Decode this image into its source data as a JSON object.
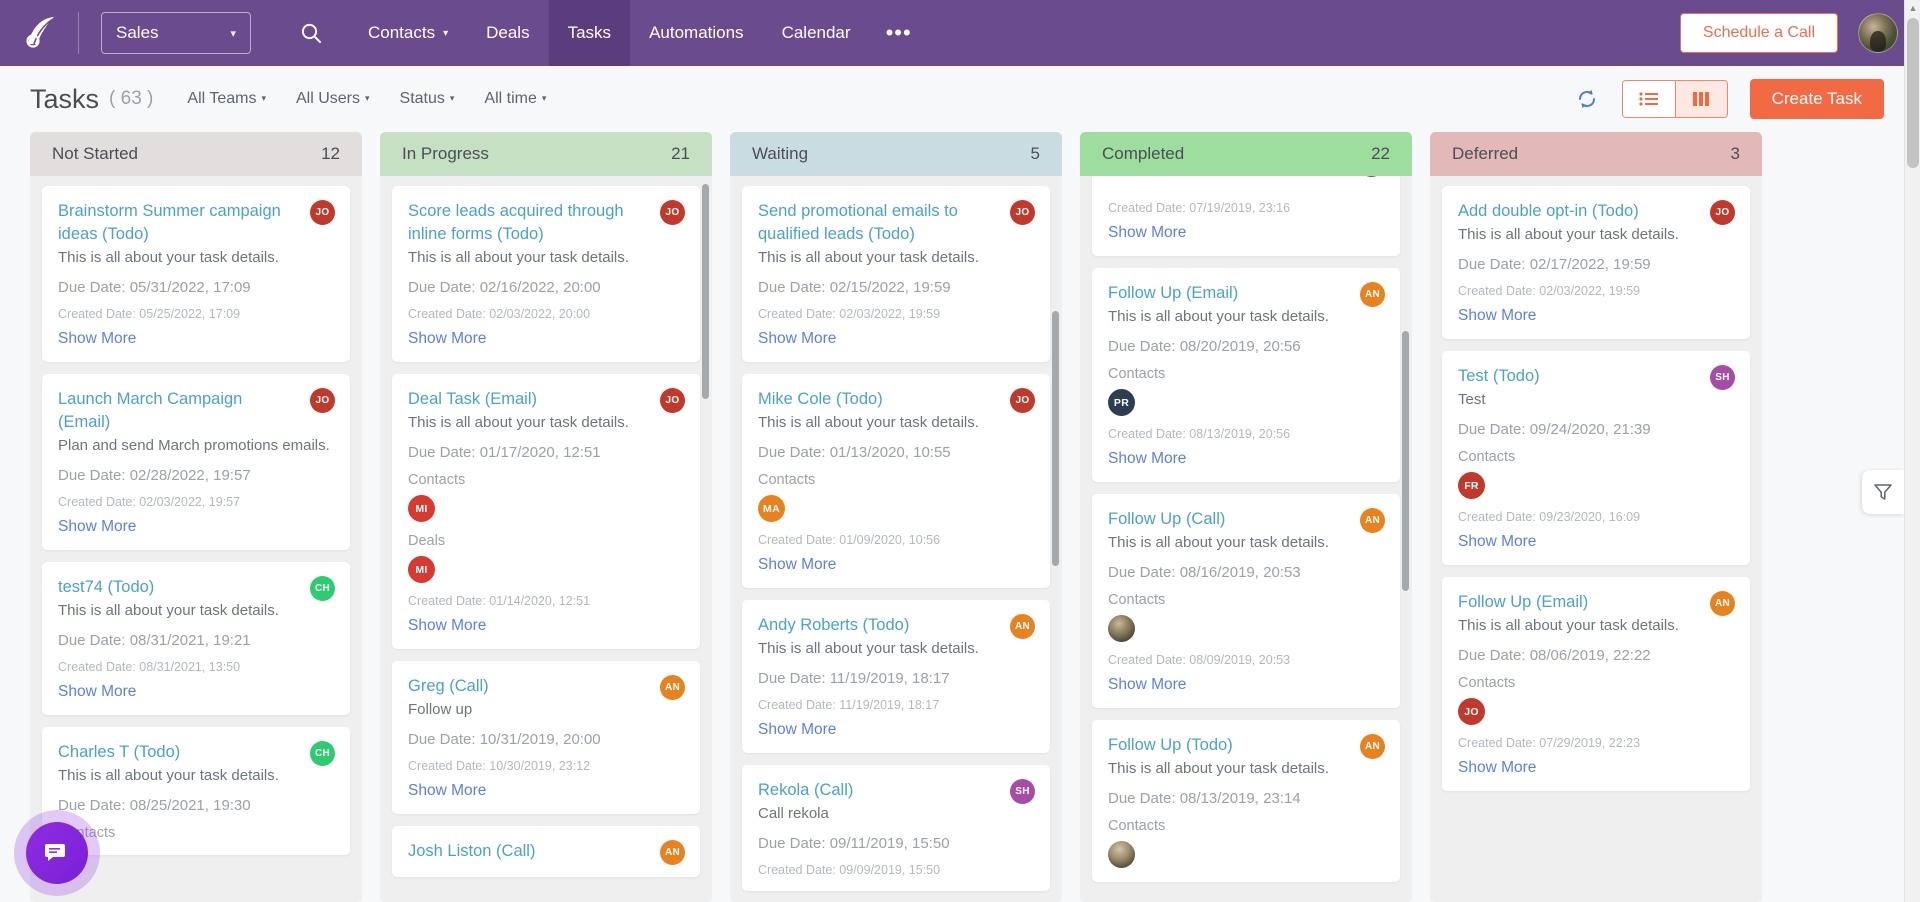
{
  "topnav": {
    "logo_name": "agile-crm-logo",
    "pipeline": {
      "label": "Sales",
      "caret": "▾"
    },
    "search_icon": "search-icon",
    "links": [
      {
        "label": "Contacts",
        "has_caret": true,
        "active": false
      },
      {
        "label": "Deals",
        "has_caret": false,
        "active": false
      },
      {
        "label": "Tasks",
        "has_caret": false,
        "active": true
      },
      {
        "label": "Automations",
        "has_caret": false,
        "active": false
      },
      {
        "label": "Calendar",
        "has_caret": false,
        "active": false
      }
    ],
    "more_label": "•••",
    "schedule_label": "Schedule a Call",
    "accent_purple": "#6a4b8e",
    "accent_orange": "#f26a44"
  },
  "toolbar": {
    "title": "Tasks",
    "count": "( 63 )",
    "filters": [
      {
        "label": "All Teams"
      },
      {
        "label": "All Users"
      },
      {
        "label": "Status"
      },
      {
        "label": "All time"
      }
    ],
    "caret": "▾",
    "refresh_icon": "refresh-icon",
    "list_view_icon": "list-view-icon",
    "board_view_icon": "board-view-icon",
    "create_label": "Create Task"
  },
  "common": {
    "due_prefix": "Due Date: ",
    "created_prefix": "Created Date: ",
    "show_more": "Show More",
    "contacts_label": "Contacts",
    "deals_label": "Deals"
  },
  "columns": [
    {
      "name": "Not Started",
      "count": "12",
      "header_bg": "#e2dedd",
      "cards": [
        {
          "title": "Brainstorm Summer campaign ideas (Todo)",
          "desc": "This is all about your task details.",
          "due": "Due Date: 05/31/2022, 17:09",
          "created": "Created Date: 05/25/2022, 17:09",
          "show_more": "Show More",
          "avatar": {
            "initials": "JO",
            "color": "#c0392b"
          }
        },
        {
          "title": "Launch March Campaign (Email)",
          "desc": "Plan and send March promotions emails.",
          "due": "Due Date: 02/28/2022, 19:57",
          "created": "Created Date: 02/03/2022, 19:57",
          "show_more": "Show More",
          "avatar": {
            "initials": "JO",
            "color": "#c0392b"
          }
        },
        {
          "title": "test74 (Todo)",
          "desc": "This is all about your task details.",
          "due": "Due Date: 08/31/2021, 19:21",
          "created": "Created Date: 08/31/2021, 13:50",
          "show_more": "Show More",
          "avatar": {
            "initials": "CH",
            "color": "#2ecc71"
          }
        },
        {
          "title": "Charles T (Todo)",
          "desc": "This is all about your task details.",
          "due": "Due Date: 08/25/2021, 19:30",
          "contacts_label": "Contacts",
          "avatar": {
            "initials": "CH",
            "color": "#2ecc71"
          }
        }
      ]
    },
    {
      "name": "In Progress",
      "count": "21",
      "header_bg": "#c5e0c3",
      "cards": [
        {
          "title": "Score leads acquired through inline forms (Todo)",
          "desc": "This is all about your task details.",
          "due": "Due Date: 02/16/2022, 20:00",
          "created": "Created Date: 02/03/2022, 20:00",
          "show_more": "Show More",
          "avatar": {
            "initials": "JO",
            "color": "#c0392b"
          }
        },
        {
          "title": "Deal Task (Email)",
          "desc": "This is all about your task details.",
          "due": "Due Date: 01/17/2020, 12:51",
          "contacts_label": "Contacts",
          "contacts": [
            {
              "initials": "MI",
              "color": "#d63a30"
            }
          ],
          "deals_label": "Deals",
          "deals": [
            {
              "initials": "MI",
              "color": "#d63a30"
            }
          ],
          "created": "Created Date: 01/14/2020, 12:51",
          "show_more": "Show More",
          "avatar": {
            "initials": "JO",
            "color": "#c0392b"
          }
        },
        {
          "title": "Greg (Call)",
          "desc": "Follow up",
          "due": "Due Date: 10/31/2019, 20:00",
          "created": "Created Date: 10/30/2019, 23:12",
          "show_more": "Show More",
          "avatar": {
            "initials": "AN",
            "color": "#e8821e"
          }
        },
        {
          "title": "Josh Liston (Call)",
          "avatar": {
            "initials": "AN",
            "color": "#e8821e"
          }
        }
      ]
    },
    {
      "name": "Waiting",
      "count": "5",
      "header_bg": "#c9dce2",
      "cards": [
        {
          "title": "Send promotional emails to qualified leads (Todo)",
          "desc": "This is all about your task details.",
          "due": "Due Date: 02/15/2022, 19:59",
          "created": "Created Date: 02/03/2022, 19:59",
          "show_more": "Show More",
          "avatar": {
            "initials": "JO",
            "color": "#c0392b"
          }
        },
        {
          "title": "Mike Cole (Todo)",
          "desc": "This is all about your task details.",
          "due": "Due Date: 01/13/2020, 10:55",
          "contacts_label": "Contacts",
          "contacts": [
            {
              "initials": "MA",
              "color": "#e8821e"
            }
          ],
          "created": "Created Date: 01/09/2020, 10:56",
          "show_more": "Show More",
          "avatar": {
            "initials": "JO",
            "color": "#c0392b"
          }
        },
        {
          "title": "Andy Roberts (Todo)",
          "desc": "This is all about your task details.",
          "due": "Due Date: 11/19/2019, 18:17",
          "created": "Created Date: 11/19/2019, 18:17",
          "show_more": "Show More",
          "avatar": {
            "initials": "AN",
            "color": "#e8821e"
          }
        },
        {
          "title": "Rekola (Call)",
          "desc": "Call rekola",
          "due": "Due Date: 09/11/2019, 15:50",
          "created": "Created Date: 09/09/2019, 15:50",
          "avatar": {
            "initials": "SH",
            "color": "#a64ca6"
          }
        }
      ]
    },
    {
      "name": "Completed",
      "count": "22",
      "header_bg": "#9ddd9d",
      "cards": [
        {
          "partial_top": true,
          "created": "Created Date: 07/19/2019, 23:16",
          "show_more": "Show More",
          "avatar": {
            "initials": "",
            "color": "#8e44ad"
          }
        },
        {
          "title": "Follow Up (Email)",
          "desc": "This is all about your task details.",
          "due": "Due Date: 08/20/2019, 20:56",
          "contacts_label": "Contacts",
          "contacts": [
            {
              "initials": "PR",
              "color": "#2c3e50"
            }
          ],
          "created": "Created Date: 08/13/2019, 20:56",
          "show_more": "Show More",
          "avatar": {
            "initials": "AN",
            "color": "#e8821e"
          }
        },
        {
          "title": "Follow Up (Call)",
          "desc": "This is all about your task details.",
          "due": "Due Date: 08/16/2019, 20:53",
          "contacts_label": "Contacts",
          "contacts": [
            {
              "initials": "",
              "color": "photo"
            }
          ],
          "created": "Created Date: 08/09/2019, 20:53",
          "show_more": "Show More",
          "avatar": {
            "initials": "AN",
            "color": "#e8821e"
          }
        },
        {
          "title": "Follow Up (Todo)",
          "desc": "This is all about your task details.",
          "due": "Due Date: 08/13/2019, 23:14",
          "contacts_label": "Contacts",
          "contacts": [
            {
              "initials": "",
              "color": "photo2"
            }
          ],
          "avatar": {
            "initials": "AN",
            "color": "#e8821e"
          }
        }
      ]
    },
    {
      "name": "Deferred",
      "count": "3",
      "header_bg": "#e3b9b8",
      "cards": [
        {
          "title": "Add double opt-in (Todo)",
          "desc": "This is all about your task details.",
          "due": "Due Date: 02/17/2022, 19:59",
          "created": "Created Date: 02/03/2022, 19:59",
          "show_more": "Show More",
          "avatar": {
            "initials": "JO",
            "color": "#c0392b"
          }
        },
        {
          "title": "Test (Todo)",
          "desc": "Test",
          "due": "Due Date: 09/24/2020, 21:39",
          "contacts_label": "Contacts",
          "contacts": [
            {
              "initials": "FR",
              "color": "#c0392b"
            }
          ],
          "created": "Created Date: 09/23/2020, 16:09",
          "show_more": "Show More",
          "avatar": {
            "initials": "SH",
            "color": "#a64ca6"
          }
        },
        {
          "title": "Follow Up (Email)",
          "desc": "This is all about your task details.",
          "due": "Due Date: 08/06/2019, 22:22",
          "contacts_label": "Contacts",
          "contacts": [
            {
              "initials": "JO",
              "color": "#c0392b"
            }
          ],
          "created": "Created Date: 07/29/2019, 22:23",
          "show_more": "Show More",
          "avatar": {
            "initials": "AN",
            "color": "#e8821e"
          }
        }
      ]
    }
  ],
  "widgets": {
    "filter_flyout_icon": "filter-funnel-icon",
    "chat_icon": "chat-bubble-icon"
  }
}
